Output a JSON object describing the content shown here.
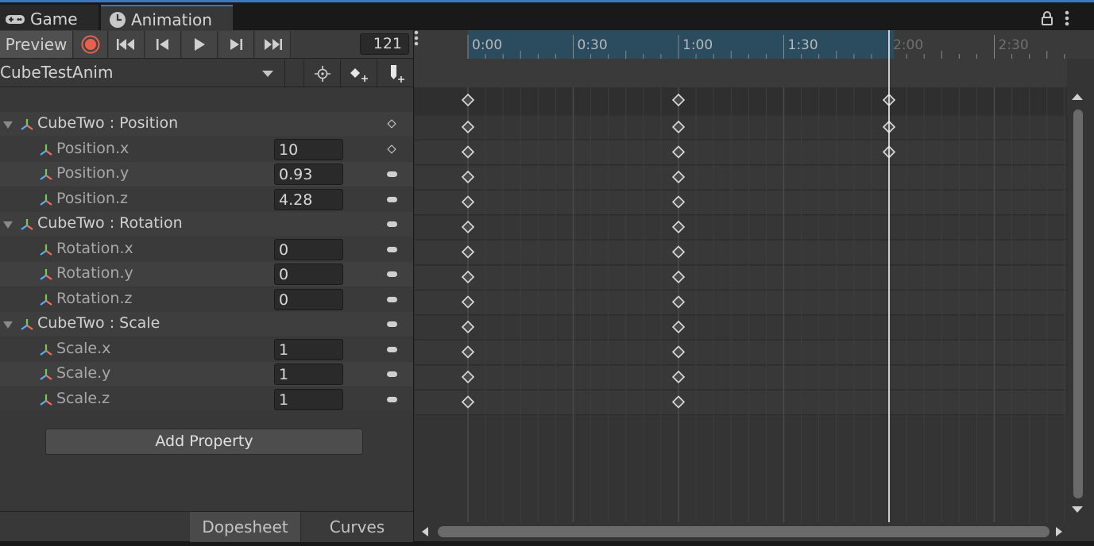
{
  "window": {
    "tabs": [
      {
        "label": "Game",
        "icon": "gamepad-icon"
      },
      {
        "label": "Animation",
        "icon": "clock-icon"
      }
    ]
  },
  "toolbar": {
    "preview_label": "Preview",
    "frame_value": "121"
  },
  "clip": {
    "name": "CubeTestAnim"
  },
  "properties": [
    {
      "label": "CubeTwo : Position",
      "type": "header",
      "key": "diamond"
    },
    {
      "label": "Position.x",
      "type": "child",
      "value": "10",
      "key": "diamond"
    },
    {
      "label": "Position.y",
      "type": "child",
      "value": "0.93",
      "key": "dash"
    },
    {
      "label": "Position.z",
      "type": "child",
      "value": "4.28",
      "key": "dash"
    },
    {
      "label": "CubeTwo : Rotation",
      "type": "header",
      "key": "dash"
    },
    {
      "label": "Rotation.x",
      "type": "child",
      "value": "0",
      "key": "dash"
    },
    {
      "label": "Rotation.y",
      "type": "child",
      "value": "0",
      "key": "dash"
    },
    {
      "label": "Rotation.z",
      "type": "child",
      "value": "0",
      "key": "dash"
    },
    {
      "label": "CubeTwo : Scale",
      "type": "header",
      "key": "dash"
    },
    {
      "label": "Scale.x",
      "type": "child",
      "value": "1",
      "key": "dash"
    },
    {
      "label": "Scale.y",
      "type": "child",
      "value": "1",
      "key": "dash"
    },
    {
      "label": "Scale.z",
      "type": "child",
      "value": "1",
      "key": "dash"
    }
  ],
  "add_property_label": "Add Property",
  "bottom_tabs": {
    "dopesheet": "Dopesheet",
    "curves": "Curves"
  },
  "timeline": {
    "labels": [
      "0:00",
      "0:30",
      "1:00",
      "1:30",
      "2:00",
      "2:30"
    ],
    "playhead_label": "2:00",
    "keyframes_summary": [
      "0:00",
      "1:00",
      "2:00"
    ],
    "keyframes_position": [
      "0:00",
      "1:00",
      "2:00"
    ],
    "keyframes_other": [
      "0:00",
      "1:00"
    ]
  },
  "colors": {
    "accent": "#3a79bb",
    "record": "#e8614a",
    "ruler_active": "#2b4b5e"
  }
}
